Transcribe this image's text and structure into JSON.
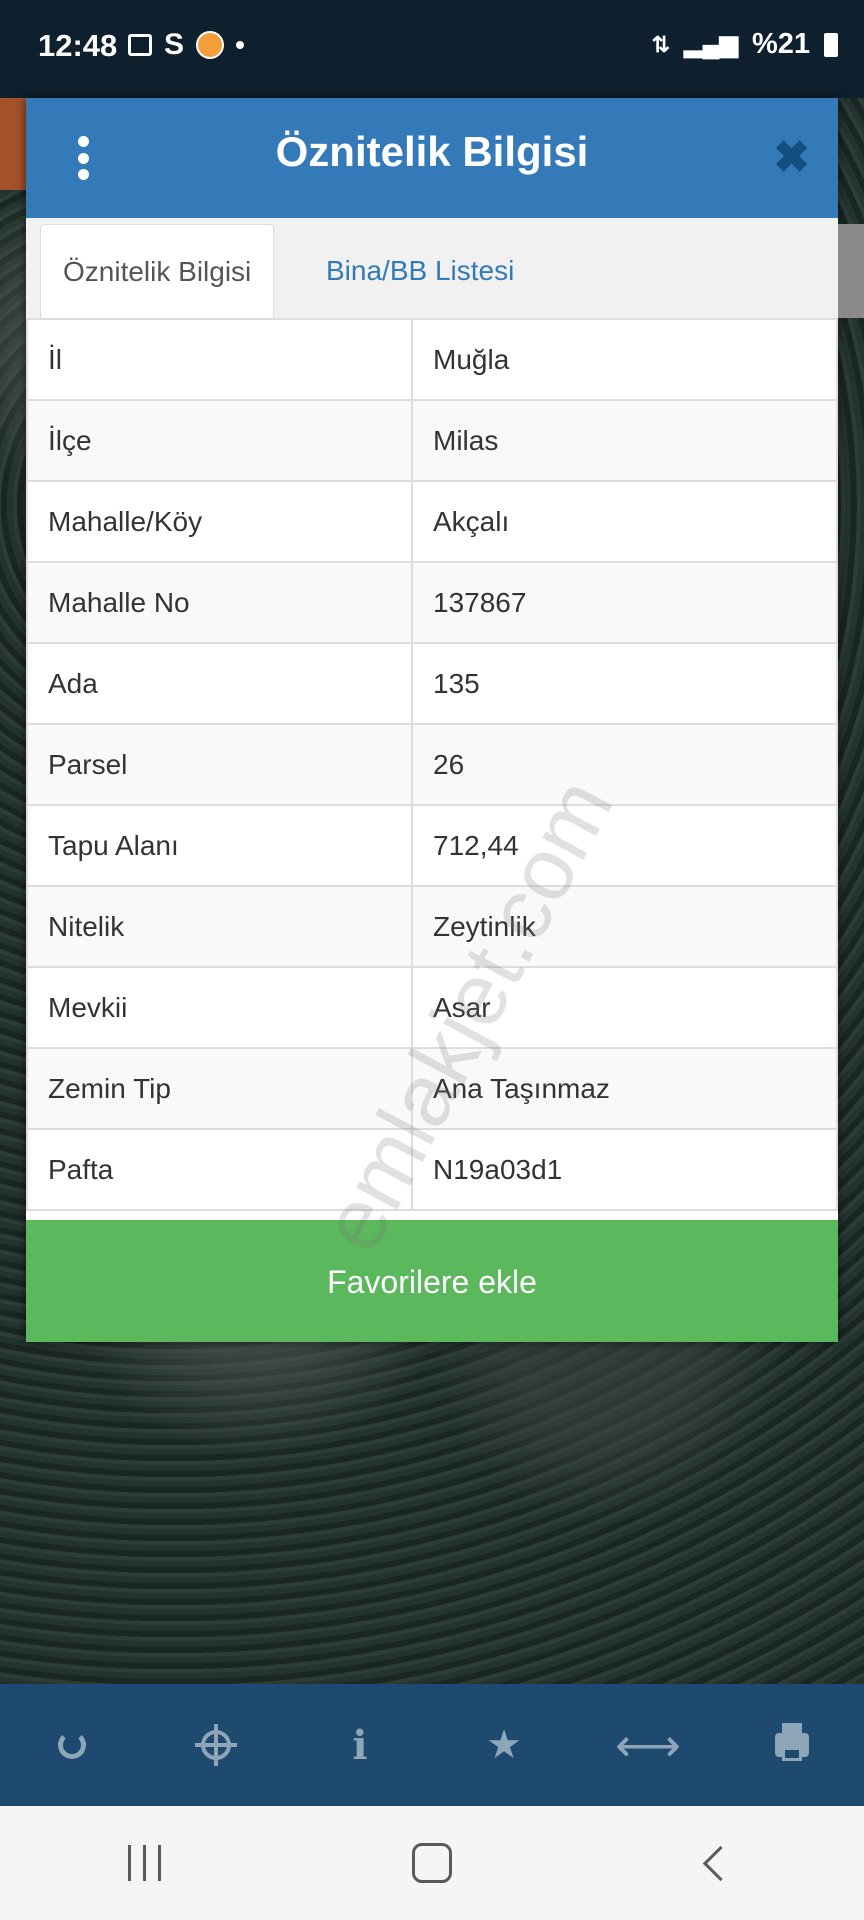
{
  "status_bar": {
    "time": "12:48",
    "battery": "%21"
  },
  "dialog": {
    "title": "Öznitelik Bilgisi",
    "tabs": [
      {
        "label": "Öznitelik Bilgisi",
        "active": true
      },
      {
        "label": "Bina/BB Listesi",
        "active": false
      }
    ],
    "rows": [
      {
        "key": "İl",
        "value": "Muğla"
      },
      {
        "key": "İlçe",
        "value": "Milas"
      },
      {
        "key": "Mahalle/Köy",
        "value": "Akçalı"
      },
      {
        "key": "Mahalle No",
        "value": "137867"
      },
      {
        "key": "Ada",
        "value": "135"
      },
      {
        "key": "Parsel",
        "value": "26"
      },
      {
        "key": "Tapu Alanı",
        "value": "712,44"
      },
      {
        "key": "Nitelik",
        "value": "Zeytinlik"
      },
      {
        "key": "Mevkii",
        "value": "Asar"
      },
      {
        "key": "Zemin Tip",
        "value": "Ana Taşınmaz"
      },
      {
        "key": "Pafta",
        "value": "N19a03d1"
      }
    ],
    "favorite_button": "Favorilere ekle"
  },
  "watermark": "emlakjet.com",
  "toolbar_icons": [
    "refresh-icon",
    "crosshair-icon",
    "info-icon",
    "star-icon",
    "arrows-horizontal-icon",
    "printer-icon"
  ],
  "colors": {
    "header": "#357ab8",
    "favorite_button": "#5cb85c",
    "toolbar": "#1d4a6e",
    "tab_link": "#337ab7"
  }
}
